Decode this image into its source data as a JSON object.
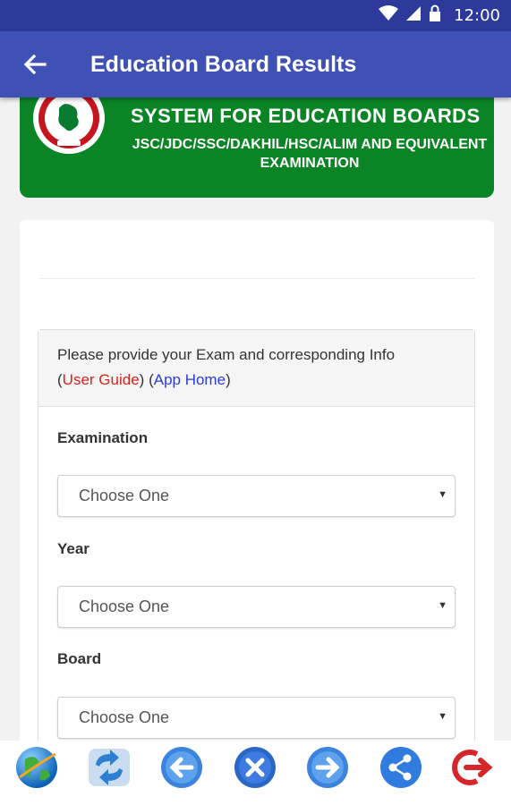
{
  "status_bar": {
    "time": "12:00"
  },
  "app_bar": {
    "title": "Education Board Results"
  },
  "banner": {
    "title": "SYSTEM FOR EDUCATION BOARDS",
    "subtitle": "JSC/JDC/SSC/DAKHIL/HSC/ALIM AND EQUIVALENT EXAMINATION",
    "brand_color": "#0b8425"
  },
  "form": {
    "intro": "Please provide your Exam and corresponding Info",
    "paren_open_1": "(",
    "user_guide": "User Guide",
    "paren_close_1": ")",
    "paren_open_2": "(",
    "app_home": "App Home",
    "paren_close_2": ")",
    "fields": [
      {
        "label": "Examination",
        "value": "Choose One"
      },
      {
        "label": "Year",
        "value": "Choose One"
      },
      {
        "label": "Board",
        "value": "Choose One"
      }
    ]
  },
  "bottom_bar": {
    "buttons": [
      {
        "icon": "globe-icon"
      },
      {
        "icon": "refresh-icon"
      },
      {
        "icon": "back-arrow-icon"
      },
      {
        "icon": "close-icon"
      },
      {
        "icon": "forward-arrow-icon"
      },
      {
        "icon": "share-icon"
      },
      {
        "icon": "exit-icon"
      }
    ]
  },
  "colors": {
    "primary": "#3f51b5",
    "primary_dark": "#2d3a9b",
    "banner": "#0b8425",
    "link_red": "#d9221c",
    "link_blue": "#2d3bd6"
  }
}
